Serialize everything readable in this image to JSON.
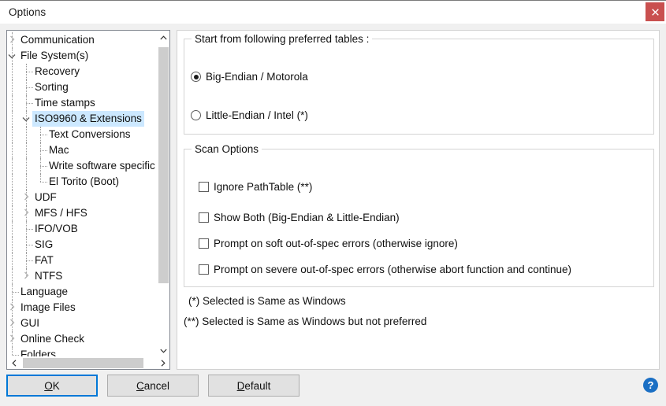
{
  "window": {
    "title": "Options",
    "close_label": "✕"
  },
  "tree": {
    "items": [
      {
        "label": "Communication",
        "depth": 0,
        "twisty": "collapsed",
        "selected": false
      },
      {
        "label": "File System(s)",
        "depth": 0,
        "twisty": "expanded",
        "selected": false
      },
      {
        "label": "Recovery",
        "depth": 1,
        "twisty": "none",
        "selected": false
      },
      {
        "label": "Sorting",
        "depth": 1,
        "twisty": "none",
        "selected": false
      },
      {
        "label": "Time stamps",
        "depth": 1,
        "twisty": "none",
        "selected": false
      },
      {
        "label": "ISO9960 & Extensions",
        "depth": 1,
        "twisty": "expanded",
        "selected": true
      },
      {
        "label": "Text Conversions",
        "depth": 2,
        "twisty": "none",
        "selected": false
      },
      {
        "label": "Mac",
        "depth": 2,
        "twisty": "none",
        "selected": false
      },
      {
        "label": "Write software specific",
        "depth": 2,
        "twisty": "none",
        "selected": false
      },
      {
        "label": "El Torito (Boot)",
        "depth": 2,
        "twisty": "none",
        "selected": false
      },
      {
        "label": "UDF",
        "depth": 1,
        "twisty": "collapsed",
        "selected": false
      },
      {
        "label": "MFS / HFS",
        "depth": 1,
        "twisty": "collapsed",
        "selected": false
      },
      {
        "label": "IFO/VOB",
        "depth": 1,
        "twisty": "none",
        "selected": false
      },
      {
        "label": "SIG",
        "depth": 1,
        "twisty": "none",
        "selected": false
      },
      {
        "label": "FAT",
        "depth": 1,
        "twisty": "none",
        "selected": false
      },
      {
        "label": "NTFS",
        "depth": 1,
        "twisty": "collapsed",
        "selected": false
      },
      {
        "label": "Language",
        "depth": 0,
        "twisty": "none",
        "selected": false
      },
      {
        "label": "Image Files",
        "depth": 0,
        "twisty": "collapsed",
        "selected": false
      },
      {
        "label": "GUI",
        "depth": 0,
        "twisty": "collapsed",
        "selected": false
      },
      {
        "label": "Online Check",
        "depth": 0,
        "twisty": "collapsed",
        "selected": false
      },
      {
        "label": "Folders",
        "depth": 0,
        "twisty": "none",
        "selected": false
      }
    ]
  },
  "tables_group": {
    "title": "Start from following preferred tables :",
    "options": [
      {
        "label": "Big-Endian / Motorola",
        "selected": true
      },
      {
        "label": "Little-Endian / Intel  (*)",
        "selected": false
      }
    ]
  },
  "scan_group": {
    "title": "Scan Options",
    "options": [
      {
        "label": "Ignore PathTable  (**)",
        "checked": false
      },
      {
        "label": "Show Both (Big-Endian & Little-Endian)",
        "checked": false
      },
      {
        "label": "Prompt on soft out-of-spec errors (otherwise ignore)",
        "checked": false
      },
      {
        "label": "Prompt on severe out-of-spec errors (otherwise abort function and continue)",
        "checked": false
      }
    ]
  },
  "notes": [
    "(*)  Selected is Same as Windows",
    "(**) Selected is Same as Windows but not preferred"
  ],
  "footer": {
    "ok": "OK",
    "ok_mnemonic": "O",
    "cancel": "Cancel",
    "cancel_mnemonic": "C",
    "default": "Default",
    "default_mnemonic": "D",
    "help": "?"
  },
  "colors": {
    "accent": "#0078d7",
    "selection": "#cce8ff",
    "close": "#c9504f",
    "help": "#1a6fc4"
  }
}
